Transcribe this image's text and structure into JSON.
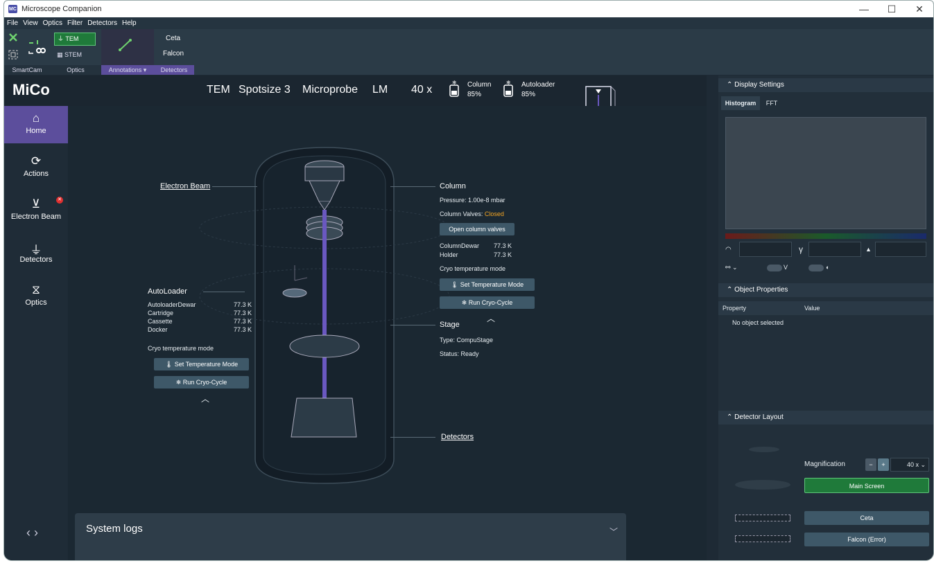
{
  "window": {
    "title": "Microscope Companion",
    "logo": "MC",
    "controls": [
      "—",
      "☐",
      "✕"
    ]
  },
  "menu": [
    "File",
    "View",
    "Optics",
    "Filter",
    "Detectors",
    "Help"
  ],
  "ribbon": {
    "groups": [
      "SmartCam",
      "Optics",
      "Annotations ▾",
      "Detectors"
    ],
    "tem": "TEM",
    "stem": "STEM",
    "ceta": "Ceta",
    "falcon": "Falcon"
  },
  "header": {
    "app": "MiCo",
    "mode": "TEM",
    "spotsize": "Spotsize 3",
    "probe": "Microprobe",
    "lm": "LM",
    "mag": "40 x",
    "column_label": "Column",
    "column_pct": "85%",
    "autoloader_label": "Autoloader",
    "autoloader_pct": "85%"
  },
  "nav": [
    {
      "label": "Home",
      "icon": "home-icon"
    },
    {
      "label": "Actions",
      "icon": "refresh-icon"
    },
    {
      "label": "Electron Beam",
      "icon": "beam-icon"
    },
    {
      "label": "Detectors",
      "icon": "detector-icon"
    },
    {
      "label": "Optics",
      "icon": "optics-icon"
    }
  ],
  "nav_arrows": "‹ ›",
  "diagram": {
    "electron_beam": "Electron Beam",
    "column": "Column",
    "pressure": "Pressure: 1.00e-8 mbar",
    "valves_label": "Column Valves:",
    "valves_state": "Closed",
    "open_valves": "Open column valves",
    "column_temps": [
      {
        "name": "ColumnDewar",
        "value": "77.3 K"
      },
      {
        "name": "Holder",
        "value": "77.3 K"
      }
    ],
    "cryo_mode": "Cryo temperature mode",
    "set_temp": "Set Temperature Mode",
    "run_cycle": "Run Cryo-Cycle",
    "autoloader": "AutoLoader",
    "al_temps": [
      {
        "name": "AutoloaderDewar",
        "value": "77.3 K"
      },
      {
        "name": "Cartridge",
        "value": "77.3 K"
      },
      {
        "name": "Cassette",
        "value": "77.3 K"
      },
      {
        "name": "Docker",
        "value": "77.3 K"
      }
    ],
    "stage": "Stage",
    "stage_type": "Type: CompuStage",
    "stage_status": "Status: Ready",
    "detectors": "Detectors"
  },
  "logs": {
    "title": "System logs"
  },
  "display": {
    "title": "Display Settings",
    "tabs": [
      "Histogram",
      "FFT"
    ],
    "v_label": "V",
    "gamma": "γ"
  },
  "object_props": {
    "title": "Object Properties",
    "col_property": "Property",
    "col_value": "Value",
    "empty": "No object selected"
  },
  "detector_layout": {
    "title": "Detector Layout",
    "mag_label": "Magnification",
    "mag_value": "40 x",
    "main_screen": "Main Screen",
    "ceta": "Ceta",
    "falcon": "Falcon (Error)"
  },
  "colors": {
    "accent": "#5c4e9c",
    "active_green": "#1f7a3a",
    "closed_orange": "#f5a623",
    "error_red": "#e03030"
  }
}
